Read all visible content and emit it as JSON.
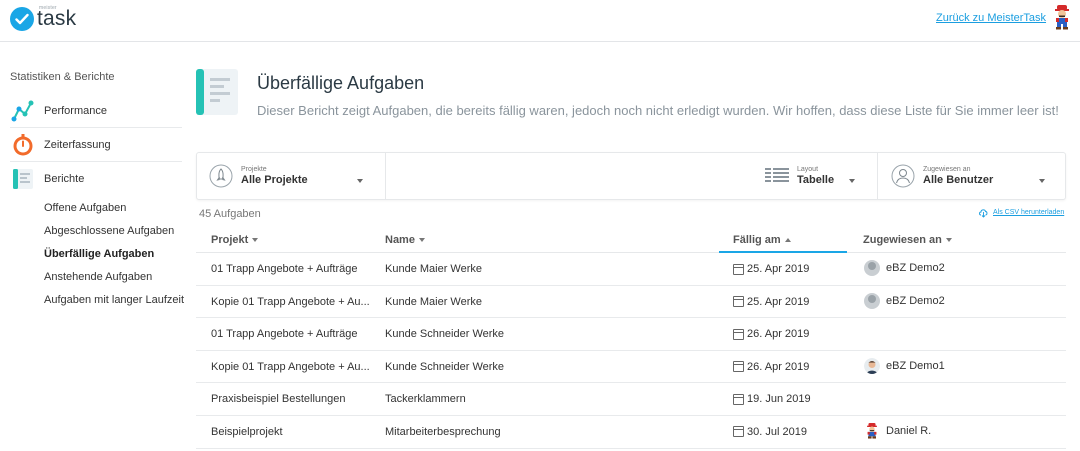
{
  "app": {
    "logo_small": "meister",
    "logo_text": "task",
    "back_link": "Zurück zu MeisterTask"
  },
  "sidebar": {
    "title": "Statistiken & Berichte",
    "nav": [
      {
        "label": "Performance",
        "icon": "performance-graph-icon"
      },
      {
        "label": "Zeiterfassung",
        "icon": "stopwatch-icon"
      },
      {
        "label": "Berichte",
        "icon": "reports-icon"
      }
    ],
    "subitems": [
      "Offene Aufgaben",
      "Abgeschlossene Aufgaben",
      "Überfällige Aufgaben",
      "Anstehende Aufgaben",
      "Aufgaben mit langer Laufzeit"
    ],
    "active_subitem": "Überfällige Aufgaben"
  },
  "main": {
    "title": "Überfällige Aufgaben",
    "description": "Dieser Bericht zeigt Aufgaben, die bereits fällig waren, jedoch noch nicht erledigt wurden. Wir hoffen, dass diese Liste für Sie immer leer ist!",
    "filters": {
      "project": {
        "label": "Projekte",
        "value": "Alle Projekte"
      },
      "layout": {
        "label": "Layout",
        "value": "Tabelle"
      },
      "assigned": {
        "label": "Zugewiesen an",
        "value": "Alle Benutzer"
      }
    },
    "count": "45 Aufgaben",
    "csv_link": "Als CSV herunterladen",
    "columns": [
      "Projekt",
      "Name",
      "Fällig am",
      "Zugewiesen an"
    ],
    "rows": [
      {
        "project": "01 Trapp Angebote + Aufträge",
        "name": "Kunde Maier Werke",
        "due": "25. Apr 2019",
        "assignee": "eBZ Demo2",
        "avatar": "gray"
      },
      {
        "project": "Kopie 01 Trapp Angebote + Au...",
        "name": "Kunde Maier Werke",
        "due": "25. Apr 2019",
        "assignee": "eBZ Demo2",
        "avatar": "gray"
      },
      {
        "project": "01 Trapp Angebote + Aufträge",
        "name": "Kunde Schneider Werke",
        "due": "26. Apr 2019",
        "assignee": "",
        "avatar": ""
      },
      {
        "project": "Kopie 01 Trapp Angebote + Au...",
        "name": "Kunde Schneider Werke",
        "due": "26. Apr 2019",
        "assignee": "eBZ Demo1",
        "avatar": "person"
      },
      {
        "project": "Praxisbeispiel Bestellungen",
        "name": "Tackerklammern",
        "due": "19. Jun 2019",
        "assignee": "",
        "avatar": ""
      },
      {
        "project": "Beispielprojekt",
        "name": "Mitarbeiterbesprechung",
        "due": "30. Jul 2019",
        "assignee": "Daniel R.",
        "avatar": "mario"
      }
    ]
  },
  "colors": {
    "accent": "#1aa6e6",
    "link": "#1a9ee0",
    "teal": "#25c2b5",
    "orange": "#f26b2b"
  }
}
